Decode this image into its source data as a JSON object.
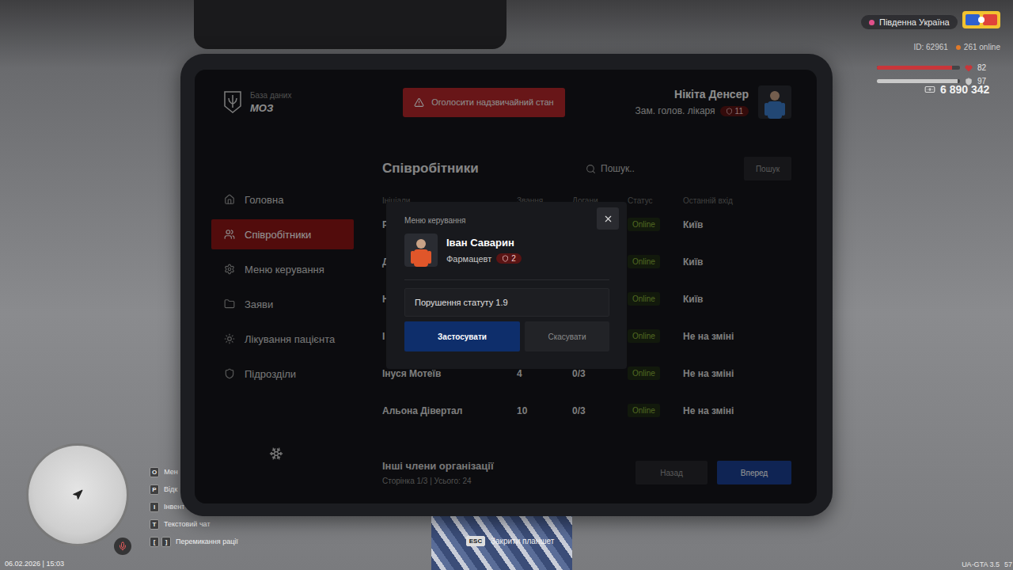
{
  "hud": {
    "server": "Південна Україна",
    "player_id": "ID: 62961",
    "online": "261 online",
    "stats": [
      {
        "kind": "health",
        "reading": "82",
        "level": 0.9,
        "color": "#c8363a"
      },
      {
        "kind": "armor",
        "reading": "97",
        "level": 0.97,
        "color": "#c9c9c9"
      }
    ],
    "money": "6 890 342",
    "hints": [
      {
        "keys": [
          "O"
        ],
        "label": "Мен"
      },
      {
        "keys": [
          "P"
        ],
        "label": "Відк"
      },
      {
        "keys": [
          "I"
        ],
        "label": "Інвент"
      },
      {
        "keys": [
          "T"
        ],
        "label": "Текстовий чат"
      },
      {
        "keys": [
          "[",
          "]"
        ],
        "label": "Перемикання рації"
      }
    ],
    "datetime": "06.02.2026 | 15:03",
    "version": "UA-GTA 3.5",
    "fps": "57",
    "close_hint": {
      "key": "ESC",
      "label": "Закрити планшет"
    }
  },
  "tablet": {
    "app_title": "База даних",
    "org": "МОЗ",
    "emergency_button": "Оголосити надзвичайний стан",
    "user": {
      "name": "Нікіта Денсер",
      "role": "Зам. голов. лікаря",
      "rank": "11"
    },
    "sidebar": {
      "items": [
        {
          "label": "Головна",
          "selected": false
        },
        {
          "label": "Співробітники",
          "selected": true
        },
        {
          "label": "Меню керування",
          "selected": false
        },
        {
          "label": "Заяви",
          "selected": false
        },
        {
          "label": "Лікування пацієнта",
          "selected": false
        },
        {
          "label": "Підрозділи",
          "selected": false
        }
      ]
    },
    "page_title": "Співробітники",
    "search": {
      "placeholder": "Пошук..",
      "button": "Пошук"
    },
    "table": {
      "columns": [
        "Ініціали",
        "Звання",
        "Догани",
        "Статус",
        "Останній вхід"
      ],
      "rows": [
        {
          "name": "Р",
          "status": "Online",
          "last_seen": "Київ"
        },
        {
          "name": "Д",
          "status": "Online",
          "last_seen": "Київ"
        },
        {
          "name": "Н",
          "status": "Online",
          "last_seen": "Київ"
        },
        {
          "name": "І",
          "status": "Online",
          "last_seen": "Не на зміні"
        },
        {
          "name": "Інуся Мотеїв",
          "rank": "4",
          "warnings": "0/3",
          "status": "Online",
          "last_seen": "Не на зміні"
        },
        {
          "name": "Альона Дівертал",
          "rank": "10",
          "warnings": "0/3",
          "status": "Online",
          "last_seen": "Не на зміні"
        }
      ]
    },
    "footer": {
      "title": "Інші члени організації",
      "pagination": "Сторінка 1/3 | Усього: 24",
      "prev": "Назад",
      "next": "Вперед"
    }
  },
  "modal": {
    "title": "Меню керування",
    "person": {
      "name": "Іван Саварин",
      "role": "Фармацевт",
      "rank": "2"
    },
    "reason": "Порушення статуту 1.9",
    "apply": "Застосувати",
    "cancel": "Скасувати"
  }
}
